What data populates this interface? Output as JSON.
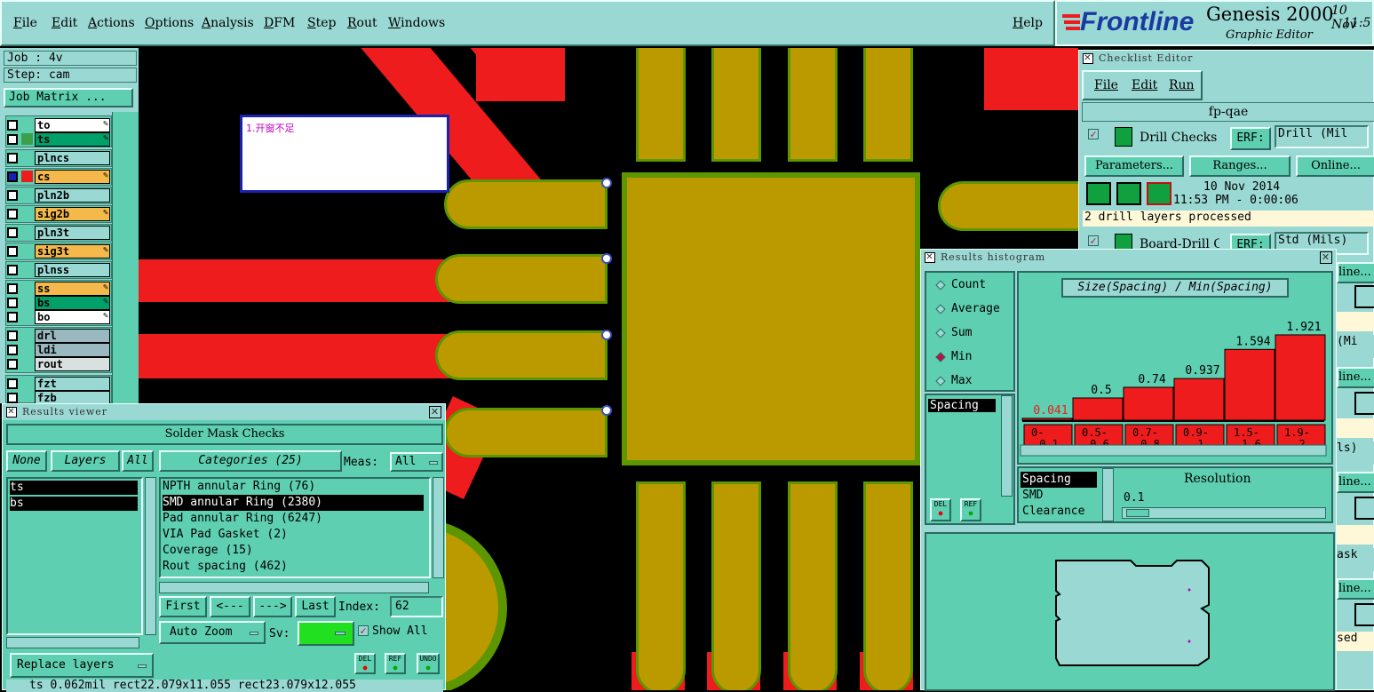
{
  "menu": {
    "items": [
      "File",
      "Edit",
      "Actions",
      "Options",
      "Analysis",
      "DFM",
      "Step",
      "Rout",
      "Windows"
    ],
    "help": "Help"
  },
  "logo": {
    "brand": "Frontline",
    "product": "Genesis 2000",
    "subtitle": "Graphic Editor",
    "date_partial": "10 Nov",
    "time_partial": "11:5"
  },
  "job": {
    "job_line": "Job : 4v",
    "step_line": "Step: cam",
    "matrix_button": "Job Matrix ..."
  },
  "layers": [
    {
      "name": "to",
      "bg": "#ffffff",
      "swatch": "",
      "editable": true
    },
    {
      "name": "ts",
      "bg": "#00a06a",
      "swatch": "#3aa04a",
      "editable": true
    },
    {
      "name": "plncs",
      "bg": "#9ad8d4",
      "swatch": "",
      "editable": false
    },
    {
      "name": "cs",
      "bg": "#f5b84a",
      "swatch": "#ee1c1c",
      "editable": true
    },
    {
      "name": "pln2b",
      "bg": "#9ad8d4",
      "swatch": "",
      "editable": false
    },
    {
      "name": "sig2b",
      "bg": "#f5b84a",
      "swatch": "",
      "editable": true
    },
    {
      "name": "pln3t",
      "bg": "#9ad8d4",
      "swatch": "",
      "editable": false
    },
    {
      "name": "sig3t",
      "bg": "#f5b84a",
      "swatch": "",
      "editable": true
    },
    {
      "name": "plnss",
      "bg": "#9ad8d4",
      "swatch": "",
      "editable": false
    },
    {
      "name": "ss",
      "bg": "#f5b84a",
      "swatch": "",
      "editable": true
    },
    {
      "name": "bs",
      "bg": "#00a06a",
      "swatch": "",
      "editable": true
    },
    {
      "name": "bo",
      "bg": "#ffffff",
      "swatch": "",
      "editable": true
    },
    {
      "name": "drl",
      "bg": "#9ab8c0",
      "swatch": "",
      "editable": false
    },
    {
      "name": "ldi",
      "bg": "#9ab8c0",
      "swatch": "",
      "editable": false
    },
    {
      "name": "rout",
      "bg": "#d8e0e0",
      "swatch": "",
      "editable": false
    },
    {
      "name": "fzt",
      "bg": "#9ad8d4",
      "swatch": "",
      "editable": false
    },
    {
      "name": "fzb",
      "bg": "#9ad8d4",
      "swatch": "",
      "editable": false
    }
  ],
  "note": {
    "text": "1.开窗不足"
  },
  "results_viewer": {
    "title": "Results viewer",
    "heading": "Solder Mask Checks",
    "none_label": "None",
    "layers_label": "Layers",
    "all_label": "All",
    "categories_label": "Categories (25)",
    "meas_label": "Meas:",
    "meas_value": "All",
    "layer_items": [
      "ts",
      "bs"
    ],
    "categories": [
      "NPTH annular Ring (76)",
      "SMD annular Ring (2380)",
      "Pad annular Ring (6247)",
      "VIA Pad Gasket (2)",
      "Coverage (15)",
      "Rout spacing (462)"
    ],
    "selected_category": 1,
    "first_btn": "First",
    "prev_btn": "<---",
    "next_btn": "--->",
    "last_btn": "Last",
    "index_label": "Index:",
    "index_value": "62",
    "zoom_label": "Auto Zoom",
    "sv_label": "Sv:",
    "show_all_label": "Show All",
    "replace_label": "Replace layers",
    "del": "DEL",
    "ref": "REF",
    "undo": "UNDO",
    "status_line": "ts 0.062mil rect22.079x11.055 rect23.079x12.055"
  },
  "histogram": {
    "title": "Results histogram",
    "modes": [
      "Count",
      "Average",
      "Sum",
      "Min",
      "Max"
    ],
    "selected_mode": "Min",
    "attr_list": [
      "Spacing"
    ],
    "del": "DEL",
    "ref": "REF",
    "resolution_label": "Resolution",
    "resolution_value": "0.1",
    "type_list": [
      "Spacing",
      "SMD",
      "Clearance"
    ]
  },
  "chart_data": {
    "type": "bar",
    "title": "Size(Spacing) / Min(Spacing)",
    "categories": [
      "0-0.1",
      "0.5-0.6",
      "0.7-0.8",
      "0.9-1",
      "1.5-1.6",
      "1.9-2"
    ],
    "category_top": [
      "0-",
      "0.5-",
      "0.7-",
      "0.9-",
      "1.5-",
      "1.9-"
    ],
    "category_bottom": [
      "0.1",
      "0.6",
      "0.8",
      "1",
      "1.6",
      "2"
    ],
    "values": [
      0.041,
      0.5,
      0.74,
      0.937,
      1.594,
      1.921
    ],
    "ylim": [
      0,
      2
    ],
    "grid": false,
    "bar_color": "#ee1c1c",
    "first_label_color": "#ee1c1c"
  },
  "checklist": {
    "title": "Checklist Editor",
    "menu": [
      "File",
      "Edit",
      "Run"
    ],
    "name": "fp-qae",
    "check1": "Drill Checks",
    "erf_label": "ERF:",
    "erf_value1": "Drill (Mil",
    "params_btn": "Parameters...",
    "ranges_btn": "Ranges...",
    "online_btn": "Online...",
    "run_date": "10 Nov 2014",
    "run_time": "11:53 PM - 0:00:06",
    "message": "2 drill layers processed",
    "check2": "Board-Drill Che",
    "erf_value2": "Std (Mils)",
    "partials": [
      "line...",
      "(Mi",
      "line...",
      "ls)",
      "line...",
      "ask",
      "line...",
      "sed"
    ]
  }
}
